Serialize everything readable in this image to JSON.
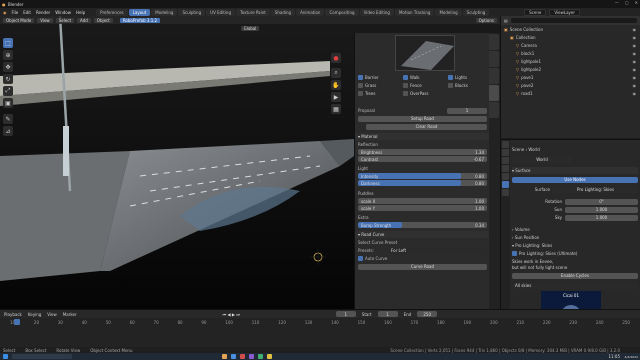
{
  "window": {
    "title": "Blender",
    "controls": [
      "—",
      "▢",
      "✕"
    ]
  },
  "menu": {
    "items": [
      "File",
      "Edit",
      "Render",
      "Window",
      "Help"
    ],
    "workspaces": [
      "Preferences",
      "Layout",
      "Modeling",
      "Sculpting",
      "UV Editing",
      "Texture Paint",
      "Shading",
      "Animation",
      "Compositing",
      "Video Editing",
      "Motion Tracking",
      "Modeling",
      "Sculpting"
    ],
    "active_index": 1,
    "scene": "Scene",
    "view_layer": "ViewLayer"
  },
  "viewport": {
    "mode": "Object Mode",
    "view": "View",
    "select": "Select",
    "add": "Add",
    "object": "Object",
    "orientation": "Global",
    "addon": "RoboPrefab 3.1.2",
    "options": "Options"
  },
  "panel": {
    "checks": [
      [
        "Barrier",
        true
      ],
      [
        "Walk",
        true
      ],
      [
        "Lights",
        true
      ],
      [
        "Grass",
        false
      ],
      [
        "Fence",
        false
      ],
      [
        "Blocks",
        false
      ],
      [
        "Trees",
        false
      ],
      [
        "OverPass",
        false
      ]
    ],
    "prop_label": "Proposal",
    "prop_value": "1",
    "setup": "Setup Road",
    "clear": "Clear Road",
    "material": "Material",
    "reflection": "Reflection",
    "brightness": {
      "label": "Brightness",
      "value": "1.34"
    },
    "contrast": {
      "label": "Contrast",
      "value": "-0.67"
    },
    "light": "Light",
    "intensity": {
      "label": "Intensity",
      "value": "0.80",
      "pct": 0.8
    },
    "darkness": {
      "label": "Darkness",
      "value": "0.80",
      "pct": 0.8
    },
    "puddles": "Puddles",
    "scale_x": {
      "label": "scale X",
      "value": "1.00"
    },
    "scale_y": {
      "label": "scale Y",
      "value": "1.00"
    },
    "extra": "Extra",
    "bump": {
      "label": "Bump Strength",
      "value": "0.34",
      "pct": 0.34
    },
    "road_curve": "Road Curve",
    "select_preset": "Select Curve Preset",
    "presets_label": "Presets:",
    "presets_value": "For Left",
    "auto_curve": "Auto Curve",
    "curve_road": "Curve Road"
  },
  "outliner": {
    "title": "Scene Collection",
    "items": [
      {
        "name": "Scene Collection",
        "indent": 0
      },
      {
        "name": "Collection",
        "indent": 1
      },
      {
        "name": "Camera",
        "indent": 2
      },
      {
        "name": "block1",
        "indent": 2
      },
      {
        "name": "lightpole1",
        "indent": 2
      },
      {
        "name": "lightpole2",
        "indent": 2
      },
      {
        "name": "pave1",
        "indent": 2
      },
      {
        "name": "pave2",
        "indent": 2
      },
      {
        "name": "road1",
        "indent": 2
      }
    ]
  },
  "properties": {
    "crumb": [
      "Scene",
      "World"
    ],
    "world": "World",
    "surface": "Surface",
    "use_nodes": "Use Nodes",
    "surface_label": "Surface",
    "surface_value": "Pro Lighting: Skies",
    "rotation": {
      "label": "Rotation",
      "value": "0°"
    },
    "sun": {
      "label": "Sun",
      "value": "1.000"
    },
    "sky": {
      "label": "Sky",
      "value": "1.000"
    },
    "volume": "Volume",
    "sun_position": "Sun Position",
    "pro_skies": "Pro Lighting: Skies",
    "pro_skies_ult": "Pro Lighting: Skies (Ultimate)",
    "note1": "Skies work in Eevee,",
    "note2": "but will not fully light scene",
    "enable_cycles": "Enable Cycles",
    "all_skies": "All skies",
    "thumb_label": "Cicai 01"
  },
  "timeline": {
    "playback": "Playback",
    "keying": "Keying",
    "view": "View",
    "marker": "Marker",
    "frame": "1",
    "start_label": "Start",
    "start": "1",
    "end_label": "End",
    "end": "250",
    "ticks": [
      "10",
      "20",
      "30",
      "40",
      "50",
      "60",
      "70",
      "80",
      "90",
      "100",
      "110",
      "120",
      "130",
      "140",
      "150",
      "160",
      "170",
      "180",
      "190",
      "200",
      "210",
      "220",
      "230",
      "240",
      "250"
    ]
  },
  "status": {
    "select": "Select",
    "box": "Box Select",
    "rotate": "Rotate View",
    "ctx": "Object Context Menu",
    "ver": "Scene Collection | Verts 2,051 | Faces 944 | Tris 1,860 | Objects 0/8 | Memory: 304.3 MiB | VRAM 0.9/8.0 GiB | 3.2.0"
  },
  "taskbar": {
    "time": "11:05",
    "date": "4/4/2022"
  },
  "colors": {
    "accent": "#4772b3",
    "bg": "#1d1d1d"
  }
}
